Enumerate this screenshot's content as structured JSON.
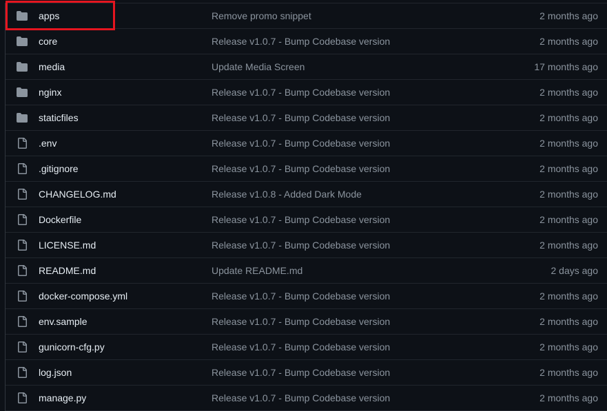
{
  "colors": {
    "background": "#0d1117",
    "highlight": "#e5151f",
    "folder_icon": "#8b949e",
    "file_icon": "#8b949e"
  },
  "files": [
    {
      "type": "folder",
      "icon": "folder-icon",
      "name": "apps",
      "message": "Remove promo snippet",
      "age": "2 months ago",
      "highlighted": true
    },
    {
      "type": "folder",
      "icon": "folder-icon",
      "name": "core",
      "message": "Release v1.0.7 - Bump Codebase version",
      "age": "2 months ago"
    },
    {
      "type": "folder",
      "icon": "folder-icon",
      "name": "media",
      "message": "Update Media Screen",
      "age": "17 months ago"
    },
    {
      "type": "folder",
      "icon": "folder-icon",
      "name": "nginx",
      "message": "Release v1.0.7 - Bump Codebase version",
      "age": "2 months ago"
    },
    {
      "type": "folder",
      "icon": "folder-icon",
      "name": "staticfiles",
      "message": "Release v1.0.7 - Bump Codebase version",
      "age": "2 months ago"
    },
    {
      "type": "file",
      "icon": "file-icon",
      "name": ".env",
      "message": "Release v1.0.7 - Bump Codebase version",
      "age": "2 months ago"
    },
    {
      "type": "file",
      "icon": "file-icon",
      "name": ".gitignore",
      "message": "Release v1.0.7 - Bump Codebase version",
      "age": "2 months ago"
    },
    {
      "type": "file",
      "icon": "file-icon",
      "name": "CHANGELOG.md",
      "message": "Release v1.0.8 - Added Dark Mode",
      "age": "2 months ago"
    },
    {
      "type": "file",
      "icon": "file-icon",
      "name": "Dockerfile",
      "message": "Release v1.0.7 - Bump Codebase version",
      "age": "2 months ago"
    },
    {
      "type": "file",
      "icon": "file-icon",
      "name": "LICENSE.md",
      "message": "Release v1.0.7 - Bump Codebase version",
      "age": "2 months ago"
    },
    {
      "type": "file",
      "icon": "file-icon",
      "name": "README.md",
      "message": "Update README.md",
      "age": "2 days ago"
    },
    {
      "type": "file",
      "icon": "file-icon",
      "name": "docker-compose.yml",
      "message": "Release v1.0.7 - Bump Codebase version",
      "age": "2 months ago"
    },
    {
      "type": "file",
      "icon": "file-icon",
      "name": "env.sample",
      "message": "Release v1.0.7 - Bump Codebase version",
      "age": "2 months ago"
    },
    {
      "type": "file",
      "icon": "file-icon",
      "name": "gunicorn-cfg.py",
      "message": "Release v1.0.7 - Bump Codebase version",
      "age": "2 months ago"
    },
    {
      "type": "file",
      "icon": "file-icon",
      "name": "log.json",
      "message": "Release v1.0.7 - Bump Codebase version",
      "age": "2 months ago"
    },
    {
      "type": "file",
      "icon": "file-icon",
      "name": "manage.py",
      "message": "Release v1.0.7 - Bump Codebase version",
      "age": "2 months ago"
    }
  ]
}
